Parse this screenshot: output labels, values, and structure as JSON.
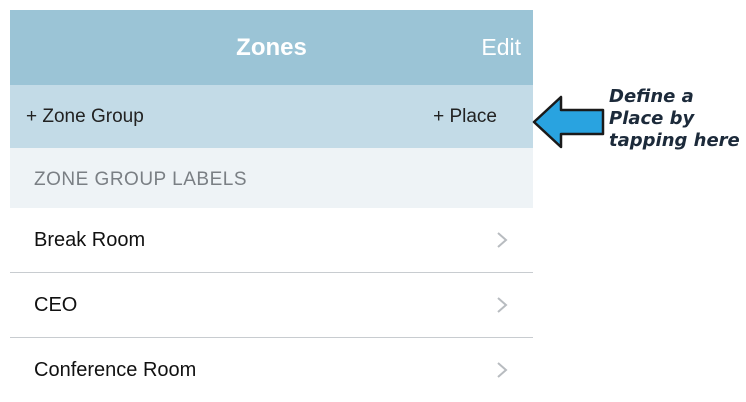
{
  "navbar": {
    "title": "Zones",
    "edit_label": "Edit"
  },
  "toolbar": {
    "add_zone_group_label": "+ Zone Group",
    "add_place_label": "+ Place"
  },
  "section": {
    "header": "ZONE GROUP LABELS"
  },
  "rows": [
    {
      "label": "Break Room"
    },
    {
      "label": "CEO"
    },
    {
      "label": "Conference Room"
    }
  ],
  "annotation": {
    "lines": [
      "Define a",
      "Place by",
      "tapping here"
    ]
  },
  "colors": {
    "navbar": "#9bc4d6",
    "toolbar": "#c3dbe7",
    "section_header": "#eef3f6",
    "arrow_fill": "#29a3e0",
    "arrow_outline": "#1a1a1a"
  },
  "icons": {
    "row_disclosure": "chevron-right-icon",
    "annotation_pointer": "arrow-left-icon"
  }
}
